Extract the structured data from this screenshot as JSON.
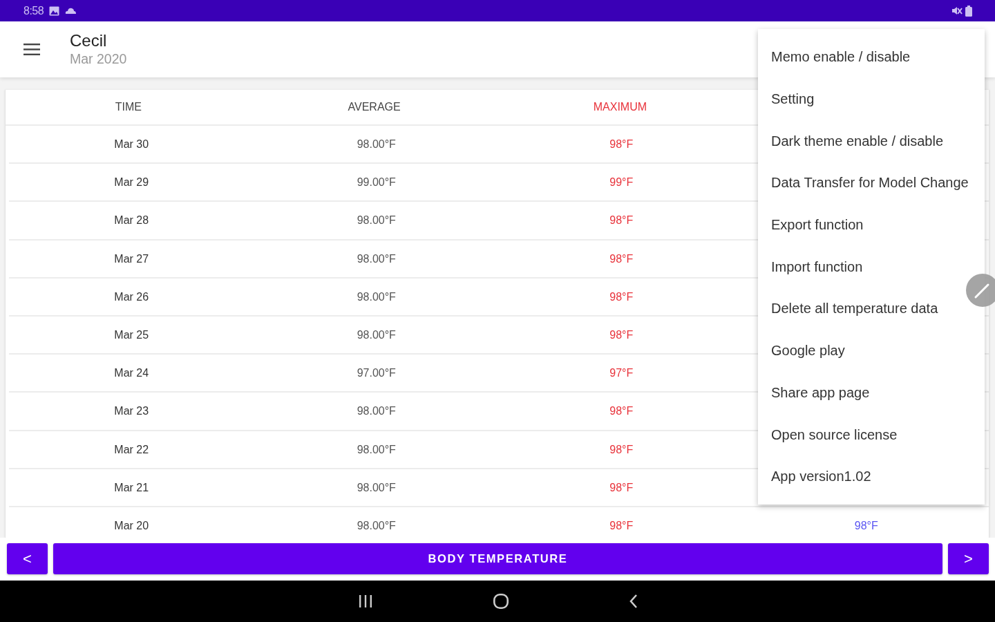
{
  "status_bar": {
    "time": "8:58"
  },
  "app_bar": {
    "title": "Cecil",
    "subtitle": "Mar 2020"
  },
  "table": {
    "columns": [
      "TIME",
      "AVERAGE",
      "MAXIMUM"
    ],
    "rows": [
      {
        "time": "Mar 30",
        "average": "98.00°F",
        "maximum": "98°F"
      },
      {
        "time": "Mar 29",
        "average": "99.00°F",
        "maximum": "99°F"
      },
      {
        "time": "Mar 28",
        "average": "98.00°F",
        "maximum": "98°F"
      },
      {
        "time": "Mar 27",
        "average": "98.00°F",
        "maximum": "98°F"
      },
      {
        "time": "Mar 26",
        "average": "98.00°F",
        "maximum": "98°F"
      },
      {
        "time": "Mar 25",
        "average": "98.00°F",
        "maximum": "98°F"
      },
      {
        "time": "Mar 24",
        "average": "97.00°F",
        "maximum": "97°F"
      },
      {
        "time": "Mar 23",
        "average": "98.00°F",
        "maximum": "98°F"
      },
      {
        "time": "Mar 22",
        "average": "98.00°F",
        "maximum": "98°F"
      },
      {
        "time": "Mar 21",
        "average": "98.00°F",
        "maximum": "98°F"
      },
      {
        "time": "Mar 20",
        "average": "98.00°F",
        "maximum": "98°F",
        "column_4": "98°F"
      }
    ]
  },
  "menu": {
    "items": [
      "Memo enable / disable",
      "Setting",
      "Dark theme enable / disable",
      "Data Transfer for Model Change",
      "Export function",
      "Import function",
      "Delete all temperature data",
      "Google play",
      "Share app page",
      "Open source license",
      "App version1.02"
    ]
  },
  "bottom_bar": {
    "prev_button": "<",
    "title_button": "BODY TEMPERATURE",
    "next_button": ">"
  }
}
